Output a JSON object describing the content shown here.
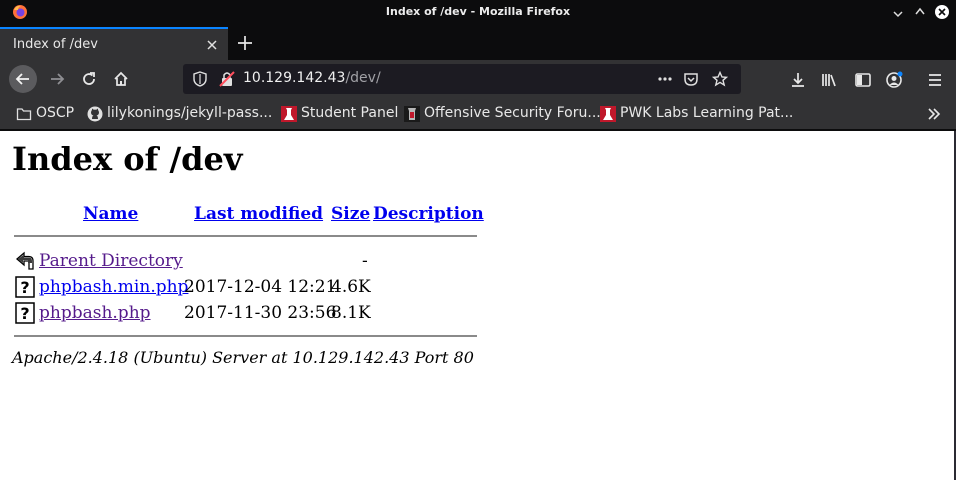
{
  "window": {
    "title": "Index of /dev - Mozilla Firefox"
  },
  "tabs": [
    {
      "label": "Index of /dev",
      "active": true
    }
  ],
  "urlbar": {
    "host": "10.129.142.43",
    "path": "/dev/"
  },
  "bookmarks": [
    {
      "label": "OSCP",
      "icon": "folder-icon"
    },
    {
      "label": "lilykonings/jekyll-pass...",
      "icon": "github-icon"
    },
    {
      "label": "Student Panel",
      "icon": "offsec-icon"
    },
    {
      "label": "Offensive Security Foru...",
      "icon": "forum-icon"
    },
    {
      "label": "PWK Labs Learning Pat...",
      "icon": "offsec-icon"
    }
  ],
  "page": {
    "heading": "Index of /dev",
    "columns": {
      "name": "Name",
      "last_modified": "Last modified",
      "size": "Size",
      "description": "Description"
    },
    "rows": [
      {
        "name": "Parent Directory",
        "date": "",
        "size": "-",
        "icon": "back-arrow-icon",
        "visited": true
      },
      {
        "name": "phpbash.min.php",
        "date": "2017-12-04 12:21",
        "size": "4.6K",
        "icon": "unknown-file-icon",
        "visited": false
      },
      {
        "name": "phpbash.php",
        "date": "2017-11-30 23:56",
        "size": "8.1K",
        "icon": "unknown-file-icon",
        "visited": true
      }
    ],
    "footer": "Apache/2.4.18 (Ubuntu) Server at 10.129.142.43 Port 80"
  },
  "colors": {
    "chrome_dark": "#0c0c0d",
    "toolbar": "#323234",
    "urlbar_bg": "#1c1b22",
    "accent": "#0a84ff",
    "link": "#0000ee",
    "visited": "#551a8b"
  }
}
